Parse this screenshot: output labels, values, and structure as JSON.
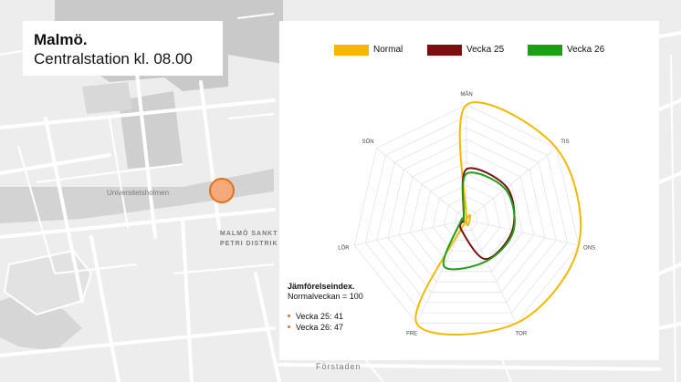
{
  "title": {
    "city": "Malmö.",
    "station": "Centralstation kl. 08.00"
  },
  "map_labels": {
    "university": "Universitetsholmen",
    "district_line1": "MALMÖ SANKT",
    "district_line2": "PETRI DISTRIK",
    "bottom": "Förstaden"
  },
  "index": {
    "title": "Jämförelseindex.",
    "subtitle": "Normalveckan = 100",
    "items": [
      "Vecka 25: 41",
      "Vecka 26: 47"
    ]
  },
  "colors": {
    "normal": "#f5b800",
    "vecka25": "#7a0f12",
    "vecka26": "#1f9e1a",
    "marker": "#f3a97a",
    "bullet": "#e86b1f"
  },
  "chart_data": {
    "type": "radar",
    "axes": [
      "MÅN",
      "TIS",
      "ONS",
      "TOR",
      "FRE",
      "LÖR",
      "SÖN"
    ],
    "rings": 10,
    "rmax": 100,
    "grid": true,
    "legend": "top",
    "series": [
      {
        "name": "Normal",
        "color": "#f5b800",
        "values": [
          100,
          100,
          100,
          100,
          100,
          0,
          0
        ]
      },
      {
        "name": "Vecka 25",
        "color": "#7a0f12",
        "values": [
          44,
          45,
          41,
          38,
          10,
          3,
          3
        ]
      },
      {
        "name": "Vecka 26",
        "color": "#1f9e1a",
        "values": [
          40,
          43,
          42,
          40,
          45,
          5,
          3
        ]
      }
    ]
  }
}
